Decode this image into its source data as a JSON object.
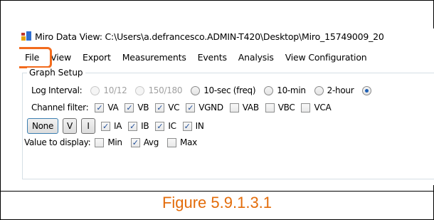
{
  "window": {
    "title": "Miro Data View: C:\\Users\\a.defrancesco.ADMIN-T420\\Desktop\\Miro_15749009_20"
  },
  "menubar": {
    "items": [
      "File",
      "View",
      "Export",
      "Measurements",
      "Events",
      "Analysis",
      "View Configuration"
    ]
  },
  "graph_setup": {
    "title": "Graph Setup",
    "log_interval": {
      "label": "Log Interval:",
      "options": [
        "10/12",
        "150/180",
        "10-sec (freq)",
        "10-min",
        "2-hour"
      ],
      "disabled": [
        "10/12",
        "150/180"
      ],
      "selected_index": 5
    },
    "channel_filter": {
      "label": "Channel filter:",
      "row1": [
        {
          "label": "VA",
          "checked": true
        },
        {
          "label": "VB",
          "checked": true
        },
        {
          "label": "VC",
          "checked": true
        },
        {
          "label": "VGND",
          "checked": true
        },
        {
          "label": "VAB",
          "checked": false
        },
        {
          "label": "VBC",
          "checked": false
        },
        {
          "label": "VCA",
          "checked": false
        }
      ],
      "row2": [
        {
          "label": "IA",
          "checked": true
        },
        {
          "label": "IB",
          "checked": true
        },
        {
          "label": "IC",
          "checked": true
        },
        {
          "label": "IN",
          "checked": true
        }
      ],
      "buttons": {
        "none": "None",
        "v": "V",
        "i": "I"
      }
    },
    "value_to_display": {
      "label": "Value to display:",
      "options": [
        {
          "label": "Min",
          "checked": false
        },
        {
          "label": "Avg",
          "checked": true
        },
        {
          "label": "Max",
          "checked": false
        }
      ]
    }
  },
  "caption": "Figure 5.9.1.3.1",
  "colors": {
    "highlight": "#F26B1D",
    "caption": "#E36C0A"
  }
}
